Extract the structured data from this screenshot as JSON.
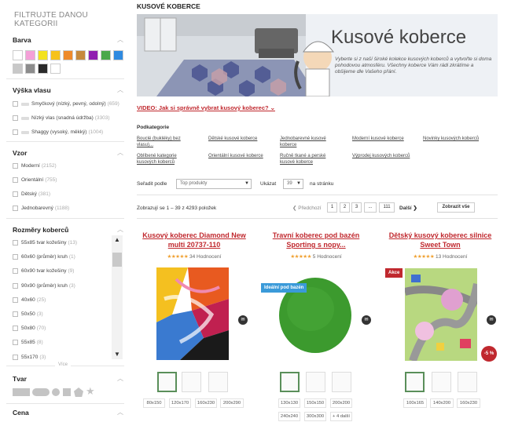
{
  "sidebar": {
    "title": "FILTRUJTE DANOU KATEGORII",
    "color_section": {
      "label": "Barva",
      "swatches": [
        "#ffffff",
        "#f4a0d8",
        "#f3e21e",
        "#f6c21c",
        "#ee8a2c",
        "#c6893c",
        "#9020b0",
        "#4aa84a",
        "#2e8ae0",
        "#c8c8c8",
        "#8c8c8c",
        "#2a2a2a",
        "#ffffff"
      ]
    },
    "pile_section": {
      "label": "Výška vlasu",
      "items": [
        {
          "label": "Smyčkový (nízký, pevný, odolný)",
          "count": "(659)"
        },
        {
          "label": "Nízký vlas (snadná údržba)",
          "count": "(3303)"
        },
        {
          "label": "Shaggy (vysoký, měkký)",
          "count": "(1004)"
        }
      ]
    },
    "pattern_section": {
      "label": "Vzor",
      "items": [
        {
          "label": "Moderní",
          "count": "(2152)"
        },
        {
          "label": "Orientální",
          "count": "(755)"
        },
        {
          "label": "Dětský",
          "count": "(381)"
        },
        {
          "label": "Jednobarevný",
          "count": "(1188)"
        }
      ]
    },
    "size_section": {
      "label": "Rozměry koberců",
      "items": [
        {
          "label": "55x85 tvar kožešiny",
          "count": "(13)"
        },
        {
          "label": "60x60 (průměr) kruh",
          "count": "(1)"
        },
        {
          "label": "60x90 tvar kožešiny",
          "count": "(9)"
        },
        {
          "label": "90x90 (průměr) kruh",
          "count": "(3)"
        },
        {
          "label": "40x60",
          "count": "(25)"
        },
        {
          "label": "50x50",
          "count": "(3)"
        },
        {
          "label": "50x80",
          "count": "(70)"
        },
        {
          "label": "55x85",
          "count": "(8)"
        },
        {
          "label": "55x170",
          "count": "(3)"
        }
      ],
      "more": "Více"
    },
    "shape_section": {
      "label": "Tvar"
    },
    "price_section": {
      "label": "Cena"
    }
  },
  "main": {
    "page_title": "KUSOVÉ KOBERCE",
    "banner": {
      "heading": "Kusové koberce",
      "text": "Vyberte si z naší široké kolekce kusových koberců a vytvořte si doma pohodovou atmosféru. Všechny koberce Vám rádi zkrátíme a obšijeme dle Vašeho přání."
    },
    "video_link": "VIDEO: Jak si správně vybrat kusový koberec? ⌄",
    "subcategories": {
      "label": "Podkategorie",
      "items": [
        "Bouclé (bukléky) bez vlasu)...",
        "Dětské kusové koberce",
        "Jednobarevné kusové koberce",
        "Moderní kusové koberce",
        "Novinky kusových koberců",
        "Oblíbené kategorie kusových koberců",
        "Orientální kusové koberce",
        "Ručně tkané a perské kusové koberce",
        "Výprodej kusových koberců"
      ]
    },
    "sort": {
      "label": "Seřadit podle",
      "value": "Top produkty",
      "show_label": "Ukázat",
      "show_value": "39",
      "per_page": "na stránku"
    },
    "pagination": {
      "showing": "Zobrazují se 1 – 39 z 4293 položek",
      "prev": "❮ Předchozí",
      "pages": [
        "1",
        "2",
        "3",
        "...",
        "111"
      ],
      "next": "Další ❯",
      "show_all": "Zobrazit vše"
    },
    "products": [
      {
        "name": "Kusový koberec Diamond New multi 20737-110",
        "rating": "★★★★★",
        "reviews": "34 Hodnocení",
        "sizes": [
          "80x150",
          "120x170",
          "160x230",
          "200x290"
        ]
      },
      {
        "name": "Travní koberec pod bazén Sporting s nopy...",
        "rating": "★★★★★",
        "reviews": "5 Hodnocení",
        "tag": "Ideální pod bazén",
        "sizes": [
          "130x130",
          "150x150",
          "200x200",
          "240x240",
          "300x300",
          "+ 4 další"
        ]
      },
      {
        "name": "Dětský kusový koberec silnice Sweet Town",
        "rating": "★★★★★",
        "reviews": "13 Hodnocení",
        "tag": "Akce",
        "discount": "-5 %",
        "sizes": [
          "100x165",
          "140x200",
          "160x230"
        ]
      }
    ],
    "mail_icon": "✉"
  },
  "colors": {
    "accent_red": "#c0282e",
    "star": "#f0a030",
    "tag_blue": "#3a9ad9"
  }
}
